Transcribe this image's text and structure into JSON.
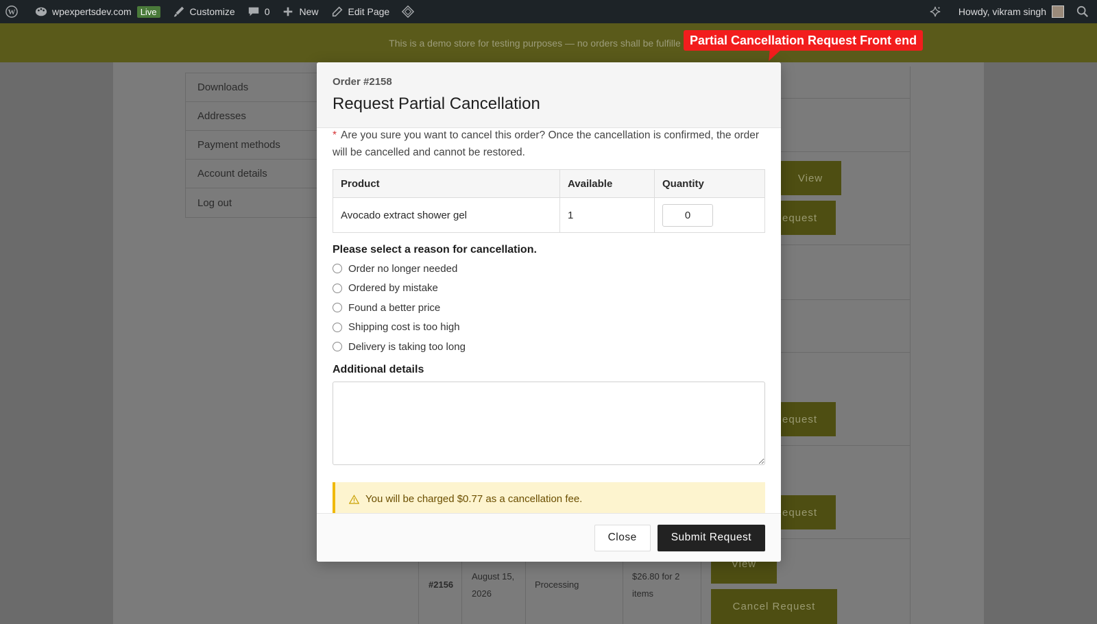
{
  "admin_bar": {
    "site_name": "wpexpertsdev.com",
    "live_badge": "Live",
    "customize": "Customize",
    "comments_count": "0",
    "new_label": "New",
    "edit_page": "Edit Page",
    "greeting": "Howdy, vikram singh"
  },
  "store_notice": "This is a demo store for testing purposes — no orders shall be fulfille",
  "callout": "Partial Cancellation Request Front end",
  "account_nav": {
    "items": [
      {
        "label": "Downloads"
      },
      {
        "label": "Addresses"
      },
      {
        "label": "Payment methods"
      },
      {
        "label": "Account details"
      },
      {
        "label": "Log out"
      }
    ]
  },
  "background_orders": {
    "view_label": "View",
    "cancel_partial": "equest",
    "cancel_full": "Cancel Request",
    "last_row": {
      "order": "#2156",
      "date_line1": "August 15,",
      "date_line2": "2026",
      "status": "Processing",
      "total_line1": "$26.80 for 2",
      "total_line2": "items"
    }
  },
  "modal": {
    "order_number": "Order #2158",
    "title": "Request Partial Cancellation",
    "required_mark": "*",
    "warning": "Are you sure you want to cancel this order? Once the cancellation is confirmed, the order will be cancelled and cannot be restored.",
    "table": {
      "headers": [
        "Product",
        "Available",
        "Quantity"
      ],
      "rows": [
        {
          "product": "Avocado extract shower gel",
          "available": "1",
          "quantity": "0"
        }
      ]
    },
    "reason_title": "Please select a reason for cancellation.",
    "reasons": [
      "Order no longer needed",
      "Ordered by mistake",
      "Found a better price",
      "Shipping cost is too high",
      "Delivery is taking too long"
    ],
    "details_title": "Additional details",
    "details_value": "",
    "fee_notice": "You will be charged $0.77 as a cancellation fee.",
    "close_label": "Close",
    "submit_label": "Submit Request"
  },
  "colors": {
    "admin_bar": "#1d2327",
    "notice_bg": "#5a5a1a",
    "callout_bg": "#f21d1d",
    "submit_bg": "#222222",
    "fee_bg": "#fdf4cf",
    "fee_border": "#f0b90b"
  },
  "icons": [
    "wordpress-logo-icon",
    "site-palette-icon",
    "brush-icon",
    "comment-icon",
    "plus-icon",
    "pencil-icon",
    "diamond-icon",
    "sparkle-icon",
    "search-icon",
    "warning-triangle-icon"
  ]
}
